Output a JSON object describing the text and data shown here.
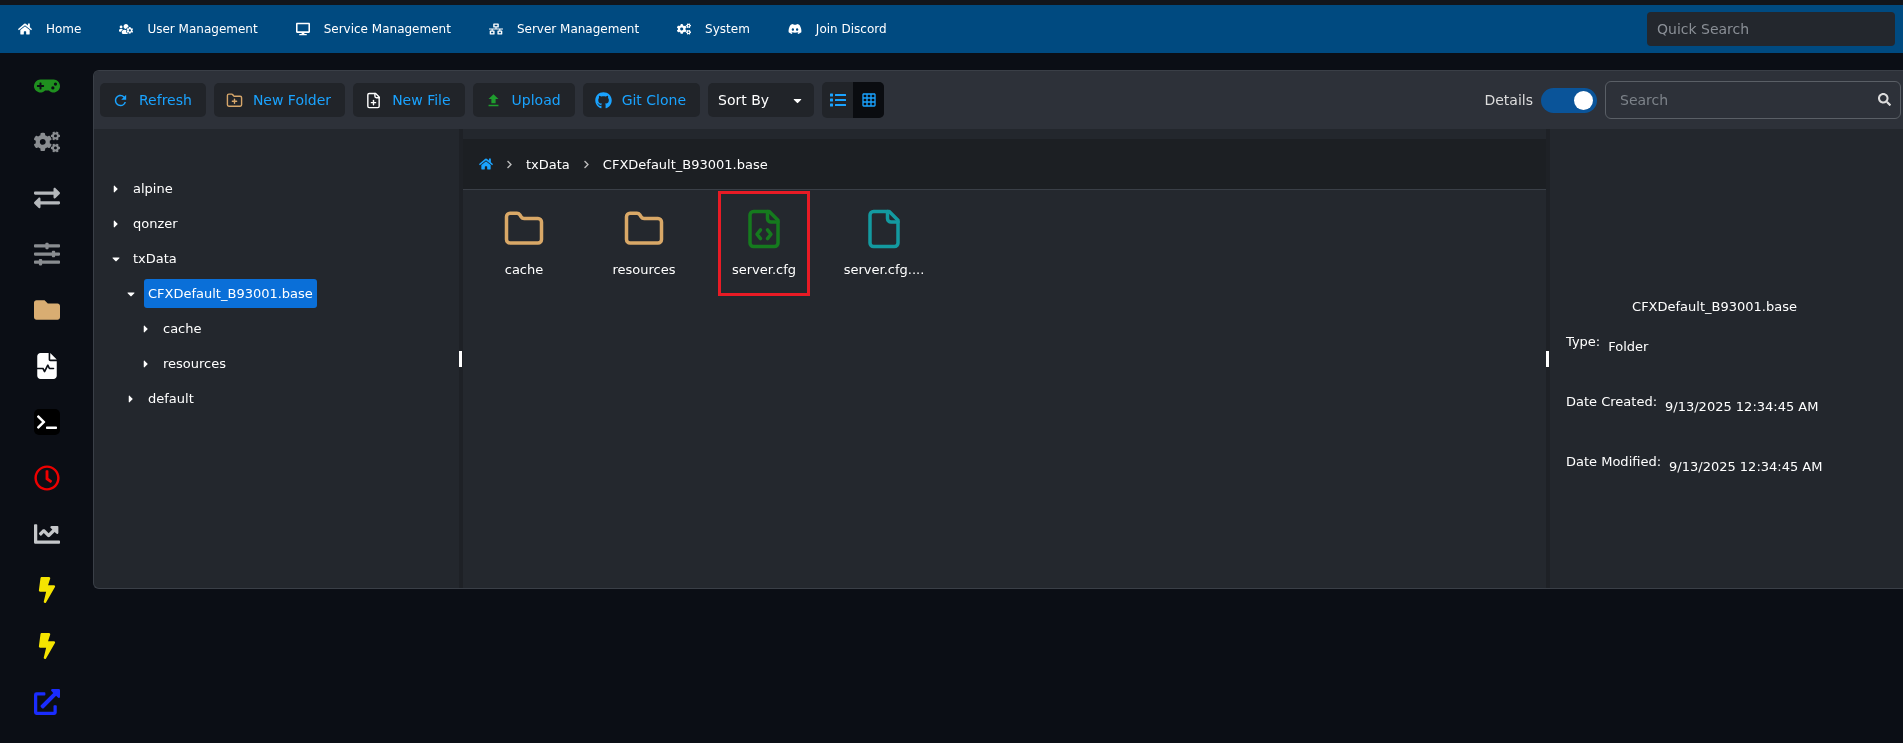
{
  "nav": {
    "items": [
      {
        "kind": "home",
        "label": "Home"
      },
      {
        "kind": "users",
        "label": "User Management"
      },
      {
        "kind": "desktop",
        "label": "Service Management"
      },
      {
        "kind": "network",
        "label": "Server Management"
      },
      {
        "kind": "cogs",
        "label": "System"
      },
      {
        "kind": "discord",
        "label": "Join Discord"
      }
    ],
    "search": {
      "placeholder": "Quick Search"
    }
  },
  "toolbar": {
    "buttons": [
      {
        "kind": "refresh",
        "label": "Refresh"
      },
      {
        "kind": "folder",
        "label": "New Folder"
      },
      {
        "kind": "file",
        "label": "New File"
      },
      {
        "kind": "upload",
        "label": "Upload"
      },
      {
        "kind": "git",
        "label": "Git Clone"
      }
    ],
    "sort": {
      "label": "Sort By"
    },
    "views": [
      {
        "kind": "list",
        "selected": false
      },
      {
        "kind": "grid",
        "selected": true
      }
    ],
    "details_toggle": {
      "label": "Details",
      "on": true
    },
    "search": {
      "placeholder": "Search"
    }
  },
  "tree": [
    {
      "label": "alpine",
      "expanded": false,
      "selected": false
    },
    {
      "label": "qonzer",
      "expanded": false,
      "selected": false
    },
    {
      "label": "txData",
      "expanded": true,
      "selected": false,
      "children": [
        {
          "label": "CFXDefault_B93001.base",
          "expanded": true,
          "selected": true,
          "children": [
            {
              "label": "cache",
              "expanded": false,
              "selected": false
            },
            {
              "label": "resources",
              "expanded": false,
              "selected": false
            }
          ]
        },
        {
          "label": "default",
          "expanded": false,
          "selected": false
        }
      ]
    }
  ],
  "breadcrumb": [
    "txData",
    "CFXDefault_B93001.base"
  ],
  "files": [
    {
      "kind": "folder",
      "name": "cache",
      "selected": false
    },
    {
      "kind": "folder",
      "name": "resources",
      "selected": false
    },
    {
      "kind": "code",
      "name": "server.cfg",
      "selected": true
    },
    {
      "kind": "file",
      "name": "server.cfg....",
      "selected": false
    }
  ],
  "details": {
    "name": "CFXDefault_B93001.base",
    "fields": [
      {
        "label": "Type:",
        "value": "Folder"
      },
      {
        "label": "Date Created:",
        "value": "9/13/2025 12:34:45 AM"
      },
      {
        "label": "Date Modified:",
        "value": "9/13/2025 12:34:45 AM"
      }
    ]
  }
}
